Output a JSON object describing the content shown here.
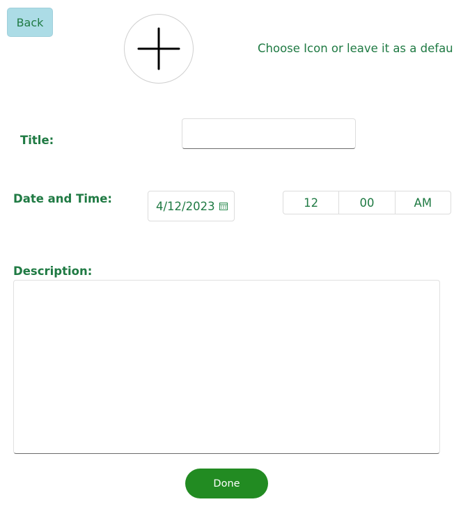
{
  "header": {
    "back_label": "Back",
    "icon_picker_icon": "plus-icon",
    "icon_hint": "Choose Icon or leave it as a default"
  },
  "form": {
    "title_label": "Title:",
    "title_value": "",
    "datetime_label": "Date and Time:",
    "date_value": "4/12/2023",
    "date_icon": "calendar-icon",
    "time": {
      "hour": "12",
      "minute": "00",
      "period": "AM"
    },
    "description_label": "Description:",
    "description_value": ""
  },
  "footer": {
    "done_label": "Done"
  },
  "colors": {
    "text_green": "#1f7a43",
    "back_bg": "#acdce6",
    "done_bg": "#228b22"
  }
}
